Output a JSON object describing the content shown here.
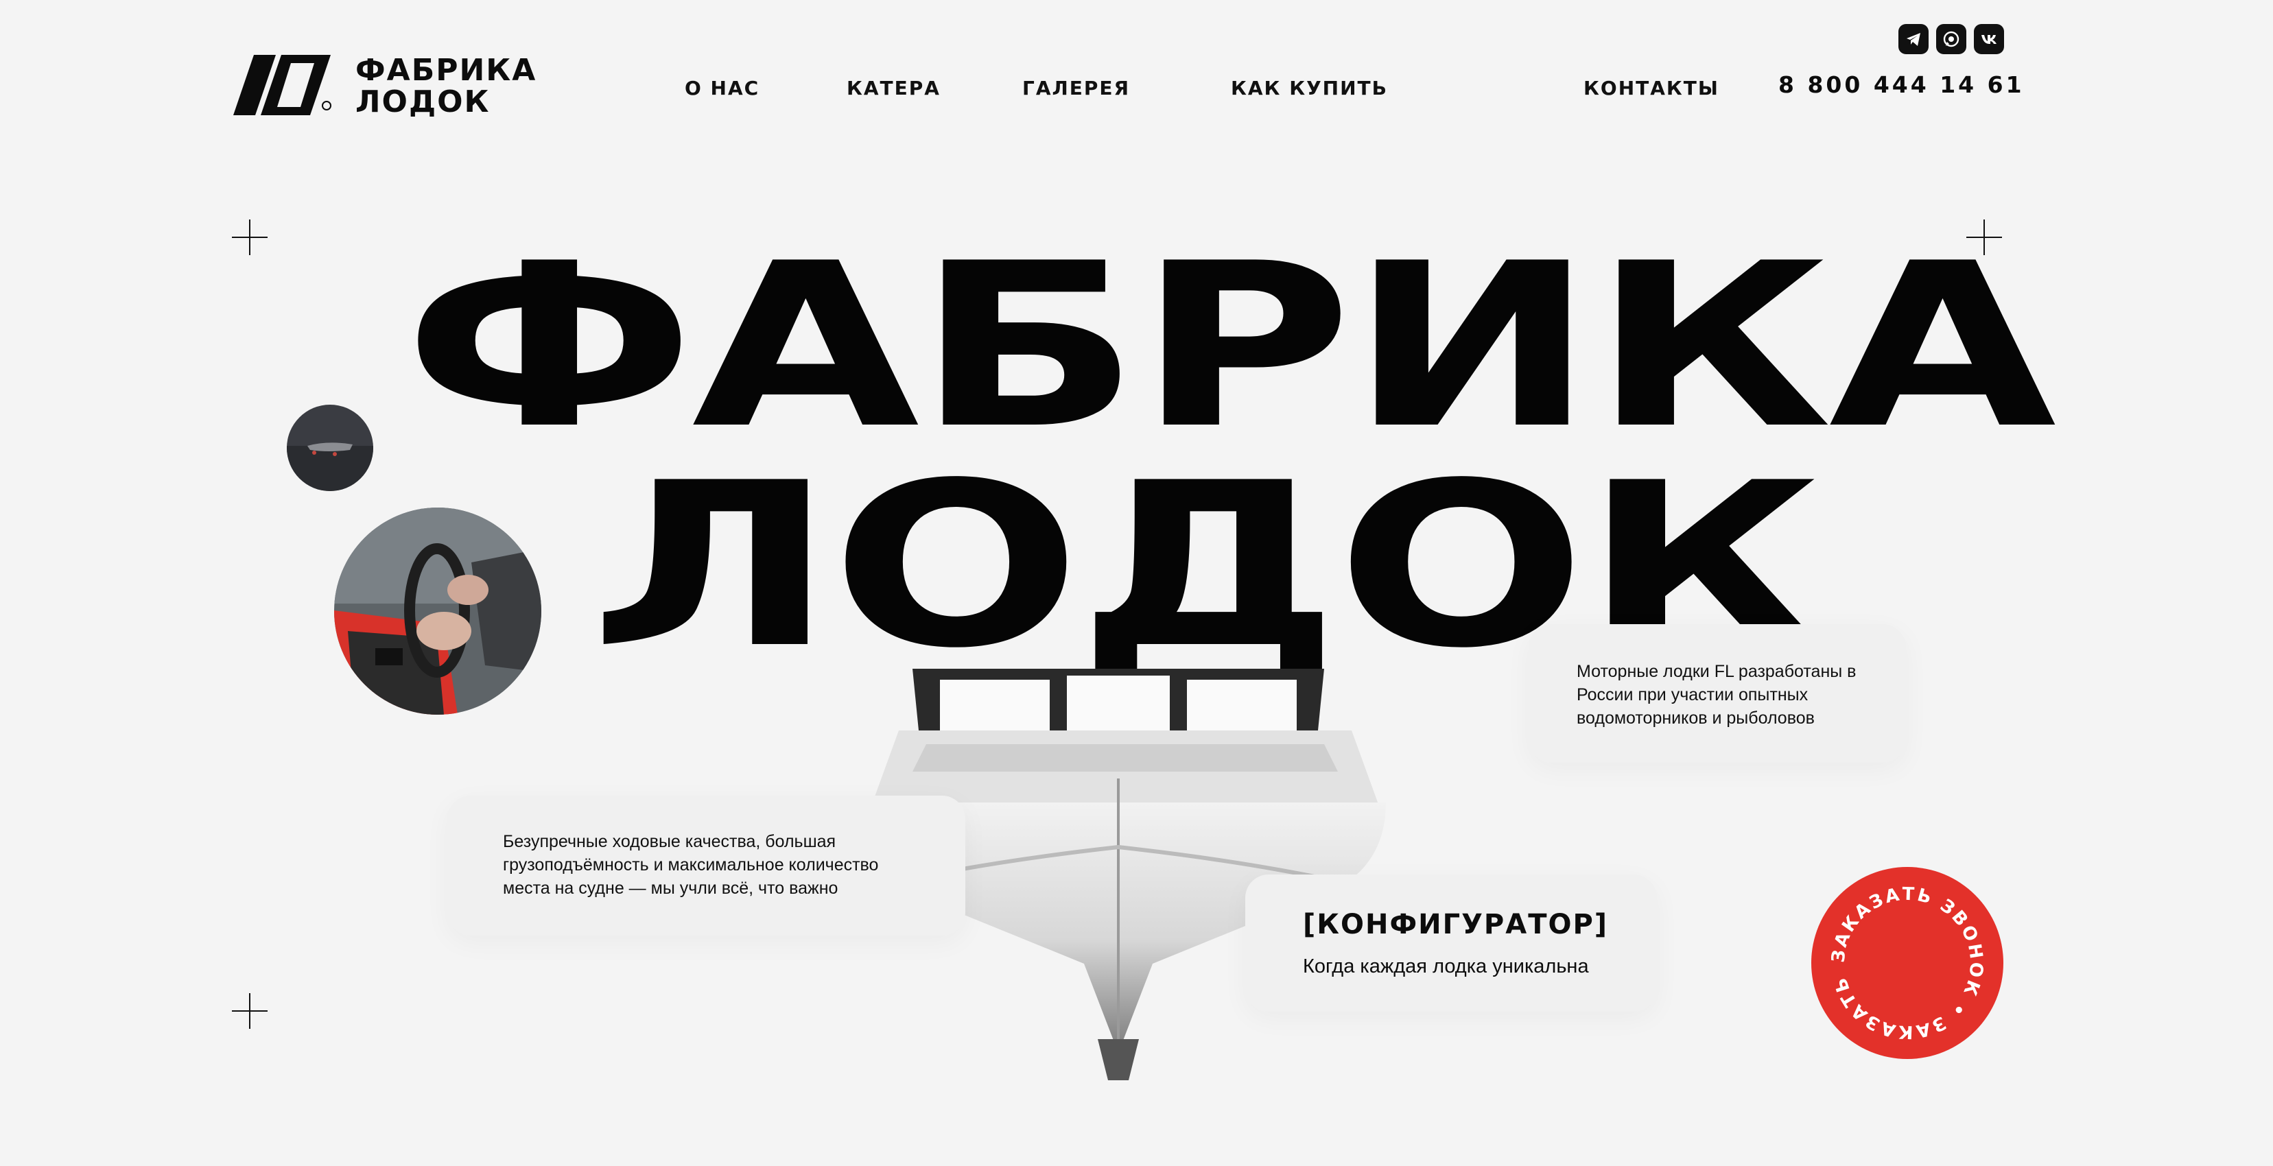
{
  "brand": {
    "line1": "ФАБРИКА",
    "line2": "ЛОДОК"
  },
  "nav": {
    "about": "О НАС",
    "boats": "КАТЕРА",
    "gallery": "ГАЛЕРЕЯ",
    "how_to_buy": "КАК КУПИТЬ",
    "contacts": "КОНТАКТЫ"
  },
  "phone": "8 800 444 14 61",
  "social": [
    "telegram-icon",
    "whatsapp-icon",
    "vk-icon"
  ],
  "hero": {
    "line1": "ФАБРИКА",
    "line2": "ЛОДОК"
  },
  "cards": {
    "about_text": "Моторные лодки FL разработаны в России при участии опытных водомоторников и рыболовов",
    "features_text": "Безупречные ходовые качества, большая грузоподъёмность и максимальное количество места на судне — мы учли всё, что важно",
    "configurator_title": "[КОНФИГУРАТОР]",
    "configurator_sub": "Когда каждая лодка уникальна"
  },
  "callback": {
    "text": "ЗАКАЗАТЬ ЗВОНОК • ЗАКАЗАТЬ ЗВОНОК •"
  },
  "colors": {
    "background": "#f4f4f4",
    "text": "#0c0c0c",
    "accent": "#e3312a"
  }
}
